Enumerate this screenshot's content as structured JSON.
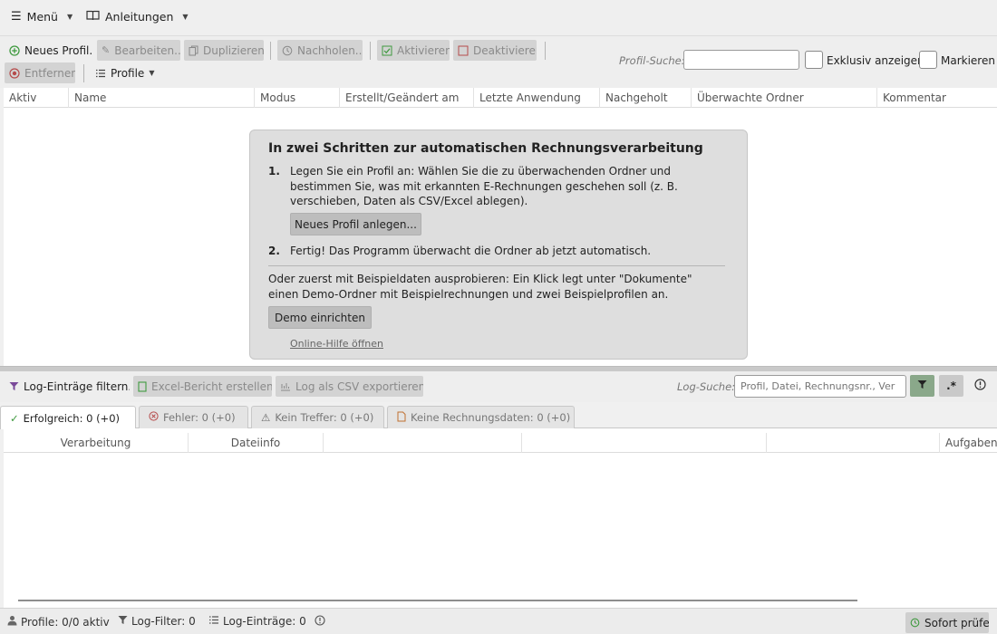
{
  "menubar": {
    "menu_label": "Menü",
    "guides_label": "Anleitungen"
  },
  "toolbar": {
    "new_profile": "Neues Profil...",
    "edit": "Bearbeiten...",
    "duplicate": "Duplizieren",
    "catchup": "Nachholen...",
    "activate": "Aktivieren",
    "deactivate": "Deaktivieren",
    "remove": "Entfernen",
    "profiles_menu": "Profile",
    "search_label": "Profil-Suche:",
    "search_value": "",
    "exclusive_label": "Exklusiv anzeigen",
    "mark_label": "Markieren"
  },
  "profile_table": {
    "columns": [
      "Aktiv",
      "Name",
      "Modus",
      "Erstellt/Geändert am",
      "Letzte Anwendung",
      "Nachgeholt",
      "Überwachte Ordner",
      "Kommentar"
    ]
  },
  "onboarding": {
    "title": "In zwei Schritten zur automatischen Rechnungsverarbeitung",
    "step1_num": "1.",
    "step1_text": "Legen Sie ein Profil an: Wählen Sie die zu überwachenden Ordner und bestimmen Sie, was mit erkannten E-Rechnungen geschehen soll (z. B. verschieben, Daten als CSV/Excel ablegen).",
    "step1_button": "Neues Profil anlegen...",
    "step2_num": "2.",
    "step2_text": "Fertig! Das Programm überwacht die Ordner ab jetzt automatisch.",
    "demo_text": "Oder zuerst mit Beispieldaten ausprobieren: Ein Klick legt unter \"Dokumente\" einen Demo-Ordner mit Beispielrechnungen und zwei Beispielprofilen an.",
    "demo_button": "Demo einrichten",
    "help_link": "Online-Hilfe öffnen"
  },
  "logbar": {
    "filter": "Log-Einträge filtern...",
    "excel": "Excel-Bericht erstellen...",
    "csv": "Log als CSV exportieren...",
    "search_label": "Log-Suche:",
    "search_placeholder": "Profil, Datei, Rechnungsnr., Ver",
    "regex_label": ".*"
  },
  "tabs": [
    {
      "label": "Erfolgreich: 0  (+0)",
      "icon": "check-icon"
    },
    {
      "label": "Fehler: 0  (+0)",
      "icon": "error-circle-icon"
    },
    {
      "label": "Kein Treffer: 0  (+0)",
      "icon": "warning-icon"
    },
    {
      "label": "Keine Rechnungsdaten: 0  (+0)",
      "icon": "document-icon"
    }
  ],
  "log_table": {
    "columns": [
      "Verarbeitung",
      "Dateiinfo",
      "",
      "",
      "Aufgabens"
    ]
  },
  "statusbar": {
    "profiles": "Profile: 0/0 aktiv",
    "log_filter": "Log-Filter: 0",
    "log_entries": "Log-Einträge: 0",
    "check_now": "Sofort prüfen"
  },
  "colors": {
    "green_button": "#8aa88a",
    "disabled_button": "#d3d3d3",
    "green_icon": "#3f9a3f",
    "red_icon": "#b64b4b"
  }
}
